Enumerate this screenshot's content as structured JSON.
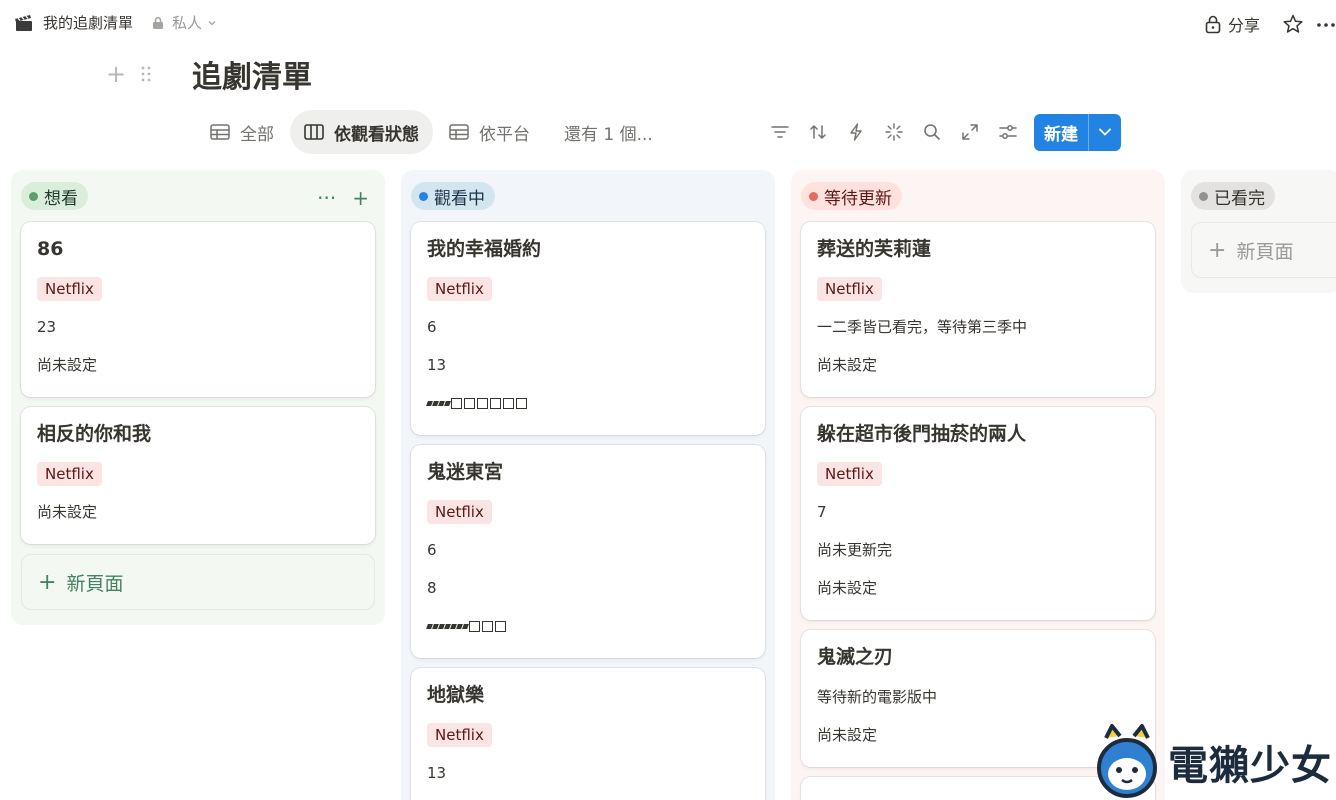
{
  "breadcrumb": {
    "icon": "clapperboard-icon",
    "title": "我的追劇清單",
    "privacy": "私人"
  },
  "topbar": {
    "share_label": "分享",
    "icons": [
      "lock-icon",
      "star-icon",
      "more-icon"
    ]
  },
  "page": {
    "title": "追劇清單"
  },
  "views": {
    "tabs": [
      {
        "label": "全部",
        "icon": "table-icon",
        "active": false
      },
      {
        "label": "依觀看狀態",
        "icon": "board-icon",
        "active": true
      },
      {
        "label": "依平台",
        "icon": "table-icon",
        "active": false
      }
    ],
    "more_label": "還有 1 個...",
    "toolbar_icons": [
      "filter-icon",
      "sort-icon",
      "automation-icon",
      "ai-icon",
      "search-icon",
      "expand-icon",
      "settings-icon"
    ],
    "new_label": "新建"
  },
  "columns": [
    {
      "label": "想看",
      "dot_color": "#5c9e6e",
      "pill_bg": "#dbeddb",
      "pill_text": "#1c3829",
      "col_bg": "#f4f8f3",
      "cards": [
        {
          "title": "86",
          "tag": "Netflix",
          "props": [
            "23",
            "尚未設定"
          ]
        },
        {
          "title": "相反的你和我",
          "tag": "Netflix",
          "props": [
            "尚未設定"
          ]
        }
      ],
      "add_label": "新頁面",
      "add_color": "#448361"
    },
    {
      "label": "觀看中",
      "dot_color": "#2383e2",
      "pill_bg": "#d3e5ef",
      "pill_text": "#183347",
      "col_bg": "#f2f6fa",
      "cards": [
        {
          "title": "我的幸福婚約",
          "tag": "Netflix",
          "props": [
            "6",
            "13"
          ],
          "progress": {
            "filled": 4,
            "total": 10
          }
        },
        {
          "title": "鬼迷東宮",
          "tag": "Netflix",
          "props": [
            "6",
            "8"
          ],
          "progress": {
            "filled": 7,
            "total": 10
          }
        },
        {
          "title": "地獄樂",
          "tag": "Netflix",
          "props": [
            "13"
          ]
        }
      ]
    },
    {
      "label": "等待更新",
      "dot_color": "#e16b5e",
      "pill_bg": "#ffe2dd",
      "pill_text": "#5d1715",
      "col_bg": "#fdf5f4",
      "cards": [
        {
          "title": "葬送的芙莉蓮",
          "tag": "Netflix",
          "props": [
            "一二季皆已看完，等待第三季中",
            "尚未設定"
          ]
        },
        {
          "title": "躲在超市後門抽菸的兩人",
          "tag": "Netflix",
          "props": [
            "7",
            "尚未更新完",
            "尚未設定"
          ]
        },
        {
          "title": "鬼滅之刃",
          "props": [
            "等待新的電影版中",
            "尚未設定"
          ]
        }
      ]
    },
    {
      "label": "已看完",
      "dot_color": "#91918e",
      "pill_bg": "#e3e2e0",
      "pill_text": "#32302c",
      "col_bg": "#f7f7f5",
      "cards": [],
      "add_label": "新頁面",
      "add_color": "#9b9a97"
    }
  ],
  "column_actions": {
    "more": "···",
    "add": "+"
  },
  "watermark": {
    "text": "電獺少女"
  }
}
